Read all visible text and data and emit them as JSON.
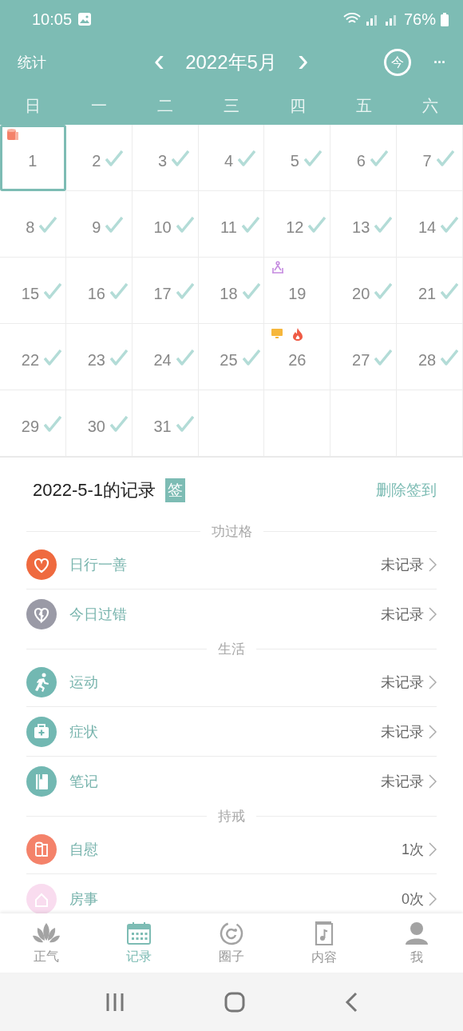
{
  "status_bar": {
    "time": "10:05",
    "battery": "76%"
  },
  "header": {
    "left": "统计",
    "prev": "‹",
    "month": "2022年5月",
    "next": "›",
    "today_button": "今",
    "more": "···"
  },
  "weekdays": [
    "日",
    "一",
    "二",
    "三",
    "四",
    "五",
    "六"
  ],
  "days": [
    {
      "day": "1",
      "selected": true,
      "checked": false,
      "marks": [
        {
          "kind": "tissue"
        }
      ]
    },
    {
      "day": "2",
      "selected": false,
      "checked": true
    },
    {
      "day": "3",
      "selected": false,
      "checked": true
    },
    {
      "day": "4",
      "selected": false,
      "checked": true
    },
    {
      "day": "5",
      "selected": false,
      "checked": true
    },
    {
      "day": "6",
      "selected": false,
      "checked": true
    },
    {
      "day": "7",
      "selected": false,
      "checked": true
    },
    {
      "day": "8",
      "selected": false,
      "checked": true
    },
    {
      "day": "9",
      "selected": false,
      "checked": true
    },
    {
      "day": "10",
      "selected": false,
      "checked": true
    },
    {
      "day": "11",
      "selected": false,
      "checked": true
    },
    {
      "day": "12",
      "selected": false,
      "checked": true
    },
    {
      "day": "13",
      "selected": false,
      "checked": true
    },
    {
      "day": "14",
      "selected": false,
      "checked": true
    },
    {
      "day": "15",
      "selected": false,
      "checked": true
    },
    {
      "day": "16",
      "selected": false,
      "checked": true
    },
    {
      "day": "17",
      "selected": false,
      "checked": true
    },
    {
      "day": "18",
      "selected": false,
      "checked": true
    },
    {
      "day": "19",
      "selected": false,
      "checked": false,
      "marks": [
        {
          "kind": "meditation"
        }
      ]
    },
    {
      "day": "20",
      "selected": false,
      "checked": true
    },
    {
      "day": "21",
      "selected": false,
      "checked": true
    },
    {
      "day": "22",
      "selected": false,
      "checked": true
    },
    {
      "day": "23",
      "selected": false,
      "checked": true
    },
    {
      "day": "24",
      "selected": false,
      "checked": true
    },
    {
      "day": "25",
      "selected": false,
      "checked": true
    },
    {
      "day": "26",
      "selected": false,
      "checked": false,
      "marks": [
        {
          "kind": "monitor"
        },
        {
          "kind": "fire"
        }
      ]
    },
    {
      "day": "27",
      "selected": false,
      "checked": true
    },
    {
      "day": "28",
      "selected": false,
      "checked": true
    },
    {
      "day": "29",
      "selected": false,
      "checked": true
    },
    {
      "day": "30",
      "selected": false,
      "checked": true
    },
    {
      "day": "31",
      "selected": false,
      "checked": true
    }
  ],
  "record": {
    "title": "2022-5-1的记录",
    "badge": "签",
    "action": "删除签到",
    "sections": [
      {
        "title": "功过格",
        "items": [
          {
            "label": "日行一善",
            "value": "未记录",
            "kind": "heart",
            "color": "#ef6a3f"
          },
          {
            "label": "今日过错",
            "value": "未记录",
            "kind": "broken-heart",
            "color": "#9a9aa6"
          }
        ]
      },
      {
        "title": "生活",
        "items": [
          {
            "label": "运动",
            "value": "未记录",
            "kind": "runner",
            "color": "#72b8b2"
          },
          {
            "label": "症状",
            "value": "未记录",
            "kind": "medkit",
            "color": "#72b8b2"
          },
          {
            "label": "笔记",
            "value": "未记录",
            "kind": "notebook",
            "color": "#72b8b2"
          }
        ]
      },
      {
        "title": "持戒",
        "items": [
          {
            "label": "自慰",
            "value": "1次",
            "kind": "tissue",
            "color": "#f4826a"
          },
          {
            "label": "房事",
            "value": "0次",
            "kind": "house",
            "color": "#f9dcef"
          }
        ]
      }
    ]
  },
  "bottom_nav": [
    {
      "label": "正气",
      "kind": "lotus",
      "selected": false
    },
    {
      "label": "记录",
      "kind": "calendar",
      "selected": true
    },
    {
      "label": "圈子",
      "kind": "circle",
      "selected": false
    },
    {
      "label": "内容",
      "kind": "music-book",
      "selected": false
    },
    {
      "label": "我",
      "kind": "person",
      "selected": false
    }
  ]
}
